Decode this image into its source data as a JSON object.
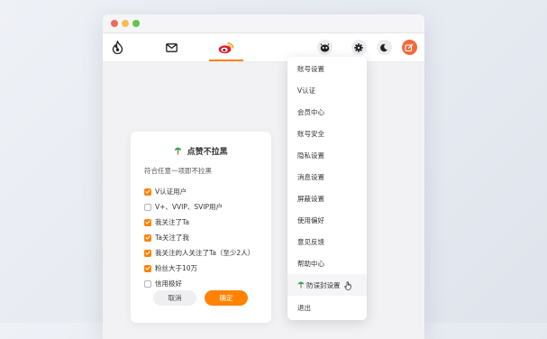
{
  "window": {
    "controls": [
      "close",
      "minimize",
      "maximize"
    ]
  },
  "nav": {
    "icons": [
      "flame-logo-icon",
      "mail-icon",
      "weibo-icon",
      "alien-avatar-icon",
      "gear-icon",
      "moon-icon",
      "compose-icon"
    ],
    "active": "weibo-icon",
    "colors": {
      "accent": "#ff8200",
      "compose": "#f26a3c"
    }
  },
  "card": {
    "title": "点赞不拉黑",
    "subtitle": "符合任意一项即不拉黑",
    "options": [
      {
        "label": "V认证用户",
        "checked": true
      },
      {
        "label": "V+、VVIP、SVIP用户",
        "checked": false
      },
      {
        "label": "我关注了Ta",
        "checked": true
      },
      {
        "label": "Ta关注了我",
        "checked": true
      },
      {
        "label": "我关注的人关注了Ta（至少2人）",
        "checked": true
      },
      {
        "label": "粉丝大于10万",
        "checked": true
      },
      {
        "label": "信用极好",
        "checked": false
      }
    ],
    "cancel_label": "取消",
    "confirm_label": "确定"
  },
  "menu": {
    "items": [
      {
        "label": "账号设置"
      },
      {
        "label": "V认证"
      },
      {
        "label": "会员中心"
      },
      {
        "label": "账号安全"
      },
      {
        "label": "隐私设置"
      },
      {
        "label": "消息设置"
      },
      {
        "label": "屏蔽设置"
      },
      {
        "label": "使用偏好"
      },
      {
        "label": "意见反馈"
      },
      {
        "label": "帮助中心"
      },
      {
        "label": "防误封设置",
        "highlighted": true
      },
      {
        "label": "退出"
      }
    ]
  }
}
